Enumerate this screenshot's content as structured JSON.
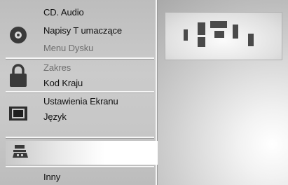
{
  "menu": {
    "items": [
      {
        "label": "CD. Audio",
        "state": "normal"
      },
      {
        "label": "Napisy T umaczące",
        "state": "normal"
      },
      {
        "label": "Menu Dysku",
        "state": "disabled"
      },
      {
        "label": "Zakres",
        "state": "disabled"
      },
      {
        "label": "Kod Kraju",
        "state": "normal"
      },
      {
        "label": "Ustawienia Ekranu",
        "state": "normal"
      },
      {
        "label": "Język",
        "state": "normal"
      },
      {
        "label": "Inny",
        "state": "normal"
      }
    ],
    "icons": [
      "disc-icon",
      "lock-icon",
      "display-icon",
      "speaker-icon"
    ]
  },
  "colors": {
    "panel_gray": "#c4c4c4",
    "icon_dark": "#3a3a3a",
    "highlight": "#ffffff"
  }
}
